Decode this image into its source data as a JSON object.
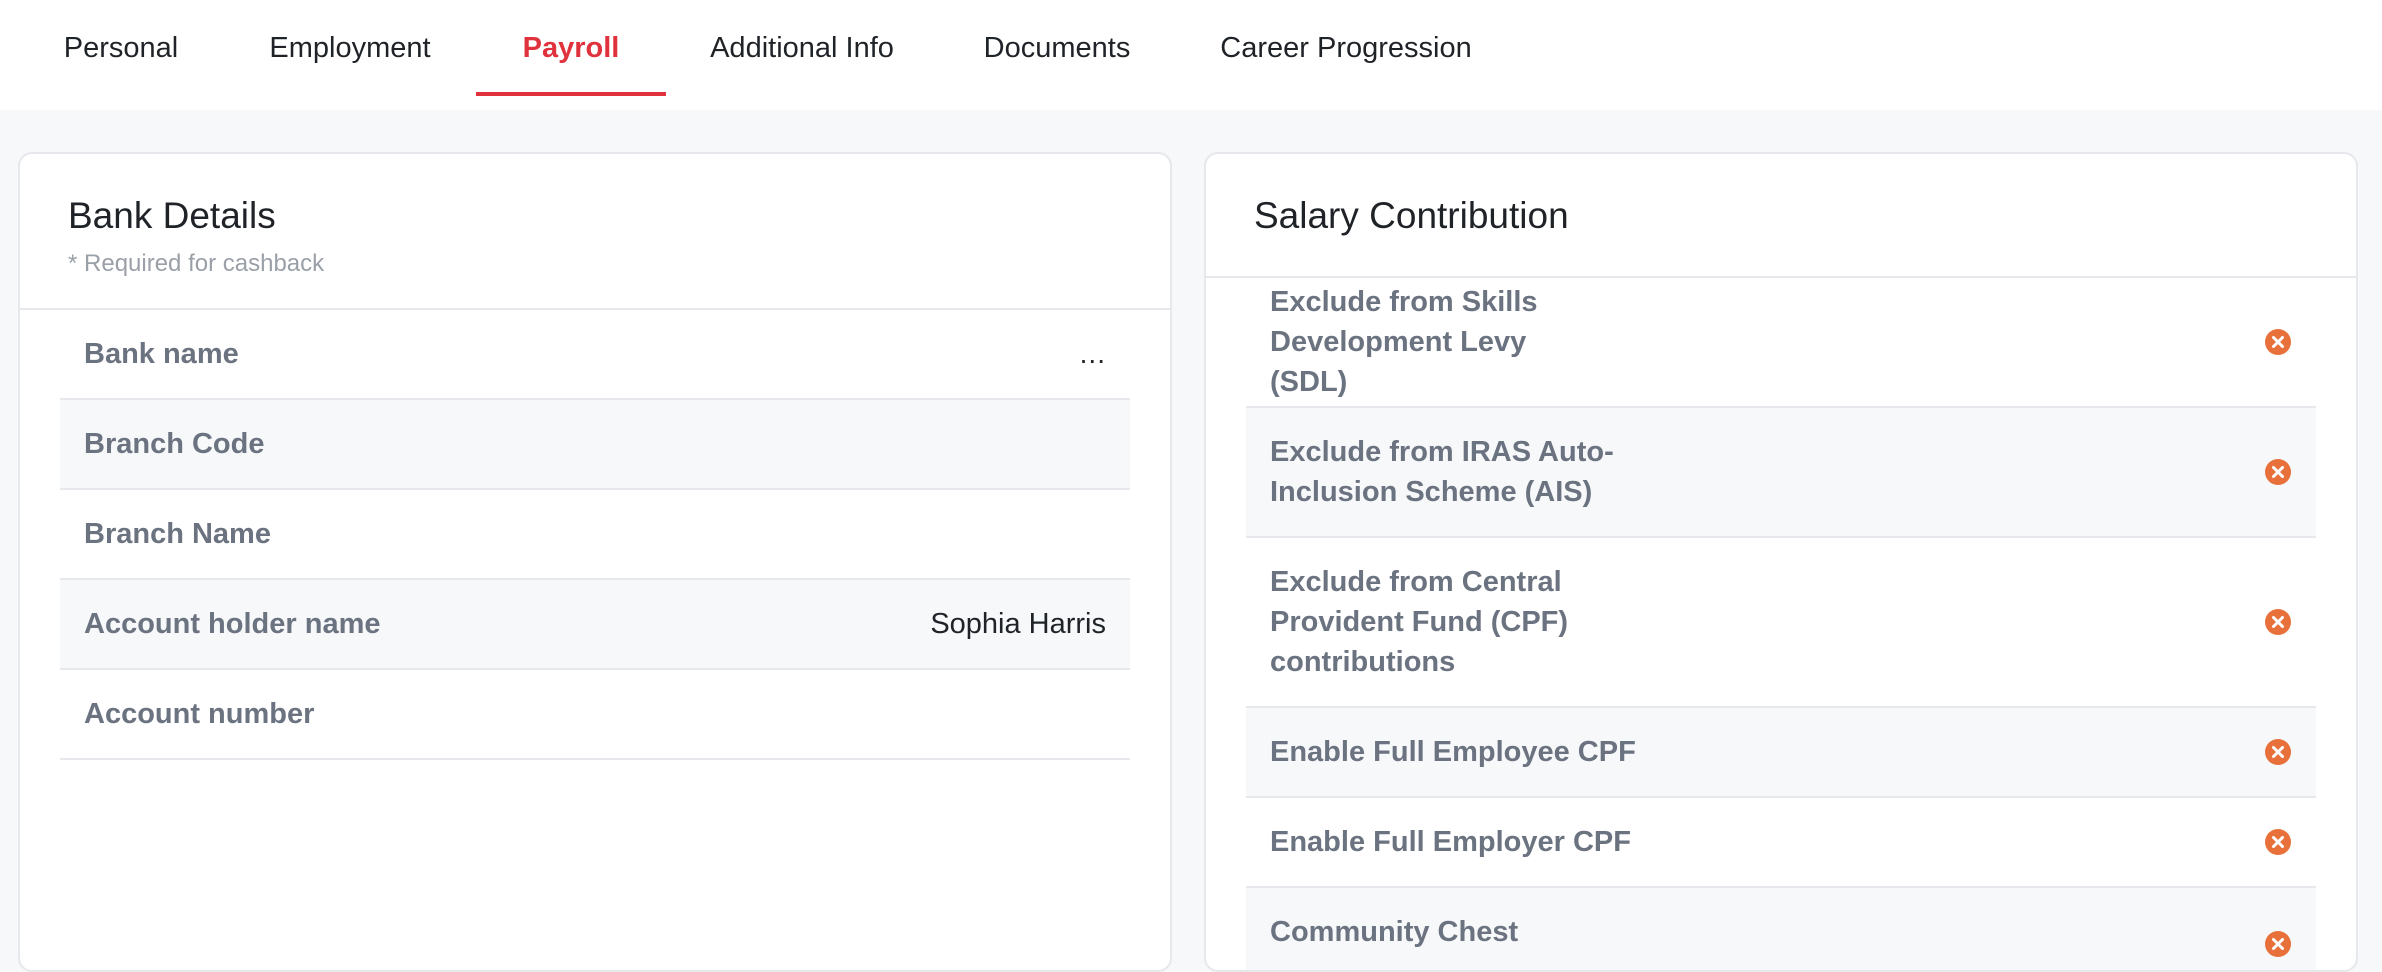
{
  "tabs": [
    {
      "label": "Personal",
      "active": false
    },
    {
      "label": "Employment",
      "active": false
    },
    {
      "label": "Payroll",
      "active": true
    },
    {
      "label": "Additional Info",
      "active": false
    },
    {
      "label": "Documents",
      "active": false
    },
    {
      "label": "Career Progression",
      "active": false
    }
  ],
  "bank": {
    "title": "Bank Details",
    "subtitle": "* Required for cashback",
    "more_label": "...",
    "rows": [
      {
        "label": "Bank name",
        "value": ""
      },
      {
        "label": "Branch Code",
        "value": ""
      },
      {
        "label": "Branch Name",
        "value": ""
      },
      {
        "label": "Account holder name",
        "value": "Sophia Harris"
      },
      {
        "label": "Account number",
        "value": ""
      }
    ]
  },
  "salary": {
    "title": "Salary Contribution",
    "rows": [
      {
        "label": "Exclude from Skills Development Levy (SDL)",
        "status": "x-circle-icon"
      },
      {
        "label": "Exclude from IRAS Auto-Inclusion Scheme (AIS)",
        "status": "x-circle-icon"
      },
      {
        "label": "Exclude from Central Provident Fund (CPF) contributions",
        "status": "x-circle-icon"
      },
      {
        "label": "Enable Full Employee CPF",
        "status": "x-circle-icon"
      },
      {
        "label": "Enable Full Employer CPF",
        "status": "x-circle-icon"
      },
      {
        "label": "Community Chest",
        "status": "x-circle-icon"
      }
    ]
  },
  "colors": {
    "accent": "#e0323c",
    "status_icon": "#e8703a"
  }
}
